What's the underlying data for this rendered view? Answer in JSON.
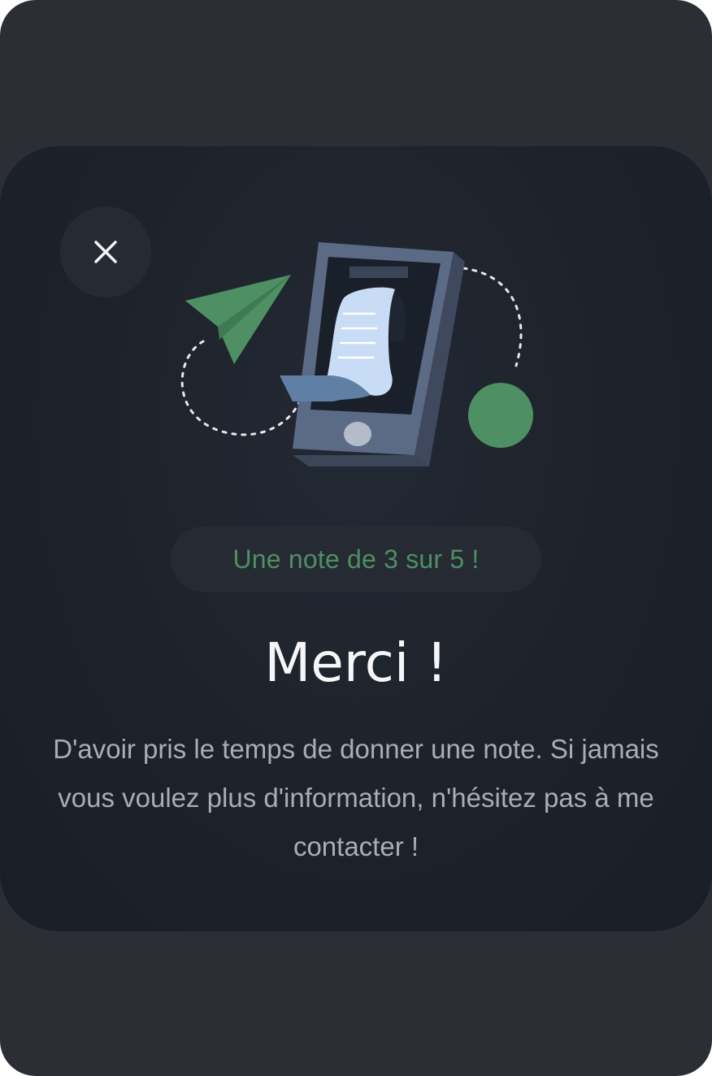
{
  "dialog": {
    "close_icon": "close-icon",
    "illustration_icon": "phone-receipt-illustration",
    "rating_text": "Une note de 3 sur 5 !",
    "title": "Merci !",
    "message": "D'avoir pris le temps de donner une note. Si jamais vous voulez plus d'information, n'hésitez pas à me contacter !"
  },
  "colors": {
    "frame_bg": "#2b2e35",
    "card_bg": "#1d222a",
    "accent_green": "#4e8f63",
    "title_text": "#f5f6f8",
    "body_text": "#a9adb5"
  }
}
